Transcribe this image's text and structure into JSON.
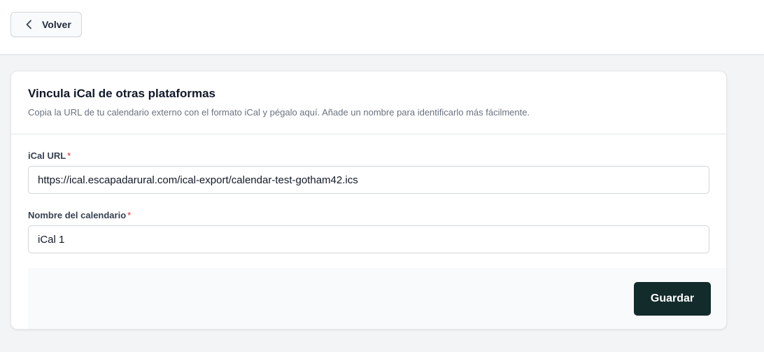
{
  "topbar": {
    "back_label": "Volver",
    "back_icon": "chevron-left-icon"
  },
  "card": {
    "title": "Vincula iCal de otras plataformas",
    "subtitle": "Copia la URL de tu calendario externo con el formato iCal y pégalo aquí. Añade un nombre para identificarlo más fácilmente.",
    "fields": {
      "url": {
        "label": "iCal URL",
        "required_mark": "*",
        "value": "https://ical.escapadarural.com/ical-export/calendar-test-gotham42.ics"
      },
      "name": {
        "label": "Nombre del calendario",
        "required_mark": "*",
        "value": "iCal 1"
      }
    },
    "save_label": "Guardar"
  },
  "colors": {
    "primary_button": "#132b2b",
    "required": "#dc2626",
    "page_background": "#f3f4f6"
  }
}
